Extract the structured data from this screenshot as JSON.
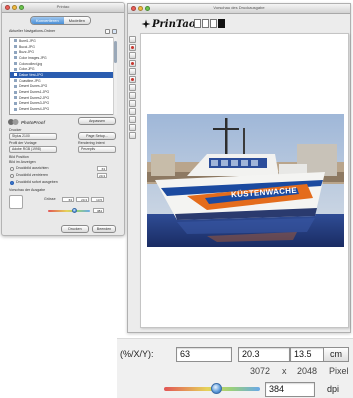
{
  "palette": {
    "title": "Printao",
    "tabs": [
      "Konvertieren",
      "Modellen"
    ],
    "active_tab": 0,
    "folder_label": "Aktueller Navigations-Ordner",
    "files": [
      "Bureß.JPG",
      "Bucci.JPG",
      "Buzz.JPG",
      "Color Images.JPG",
      "Colorcollect.jpg",
      "Color.JPG",
      "Dakar Vest.JPG",
      "Coastline.JPG",
      "Desert Dunes.JPG",
      "Desert Dunes1.JPG",
      "Desert Dunes2.JPG",
      "Desert Dunes3.JPG",
      "Desert Dunes4.JPG"
    ],
    "selected_file_index": 6,
    "logo_label": "PhotoProof",
    "logo_button": "Anpassen",
    "printer_label": "Drucker",
    "printer_value": "Stylus 2100",
    "page_setup_button": "Page Setup...",
    "profile_label": "Profil der Vorlage",
    "profile_value": "Adobe RGB (1998)",
    "rendering_label": "Rendering Intent",
    "rendering_value": "Perzeptiv",
    "size_label": "Bild Position",
    "size_sub": "Bild im Anzeigen",
    "options": [
      "Druckbild ausrichten",
      "Druckbild zentrieren",
      "Druckbild sofort ausgeben"
    ],
    "active_option": 2,
    "preview_label": "Vorschau der Ausgabe",
    "values_label": "Grösse",
    "mini_values": [
      "63",
      "20.3",
      "13.5"
    ],
    "print_button": "Drucken",
    "quit_button": "Beenden"
  },
  "document": {
    "title": "Vorschau des Druckausgabe",
    "brand": "PrinTao",
    "page_count": 4,
    "active_page": 4,
    "photo_caption": "KÜSTENWACHE"
  },
  "zoom_panel": {
    "label": "(%/X/Y):",
    "percent": "63",
    "width": "20.3",
    "height": "13.5",
    "unit": "cm",
    "pixel_w": "3072",
    "times": "x",
    "pixel_h": "2048",
    "pixel_unit": "Pixel",
    "slider_level": 0.55,
    "dpi": "384",
    "dpi_unit": "dpi"
  },
  "colors": {
    "accent": "#3b7bd0",
    "selection": "#2a5db0",
    "boat_hull_white": "#f4f4f2",
    "boat_stripe_blue": "#1b4aa0",
    "boat_stripe_orange": "#e46c1c",
    "boat_cabin": "#2b4d9a",
    "sea": "#243c8a"
  }
}
